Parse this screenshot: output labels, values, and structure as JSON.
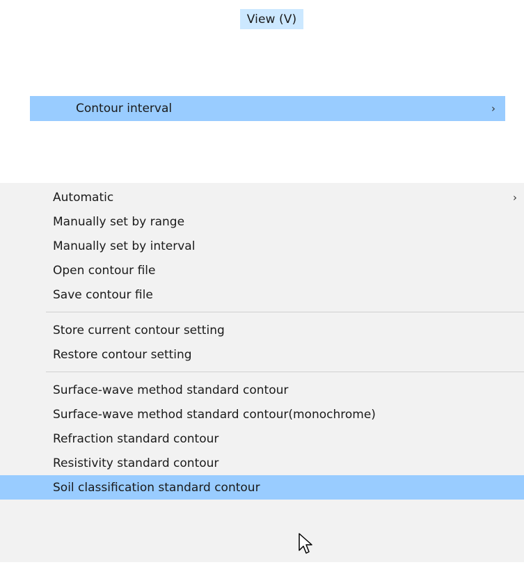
{
  "menubar": {
    "view_label": "View (V)"
  },
  "submenu": {
    "contour_interval_label": "Contour interval",
    "chevron": "›"
  },
  "menu": {
    "group1": [
      {
        "label": "Automatic",
        "has_submenu": true
      },
      {
        "label": "Manually set by range"
      },
      {
        "label": "Manually set by interval"
      },
      {
        "label": "Open contour file"
      },
      {
        "label": "Save contour file"
      }
    ],
    "group2": [
      {
        "label": "Store current contour setting"
      },
      {
        "label": "Restore contour setting"
      }
    ],
    "group3": [
      {
        "label": "Surface-wave method standard contour"
      },
      {
        "label": "Surface-wave method standard contour(monochrome)"
      },
      {
        "label": "Refraction standard contour"
      },
      {
        "label": "Resistivity standard contour"
      },
      {
        "label": "Soil classification standard contour",
        "highlighted": true
      }
    ],
    "chevron": "›"
  },
  "colors": {
    "menubar_highlight": "#cce8ff",
    "item_highlight": "#99ccff",
    "menu_background": "#f2f2f2",
    "separator": "#d0d0d0"
  },
  "icons": {
    "cursor": "arrow-pointer-icon"
  }
}
